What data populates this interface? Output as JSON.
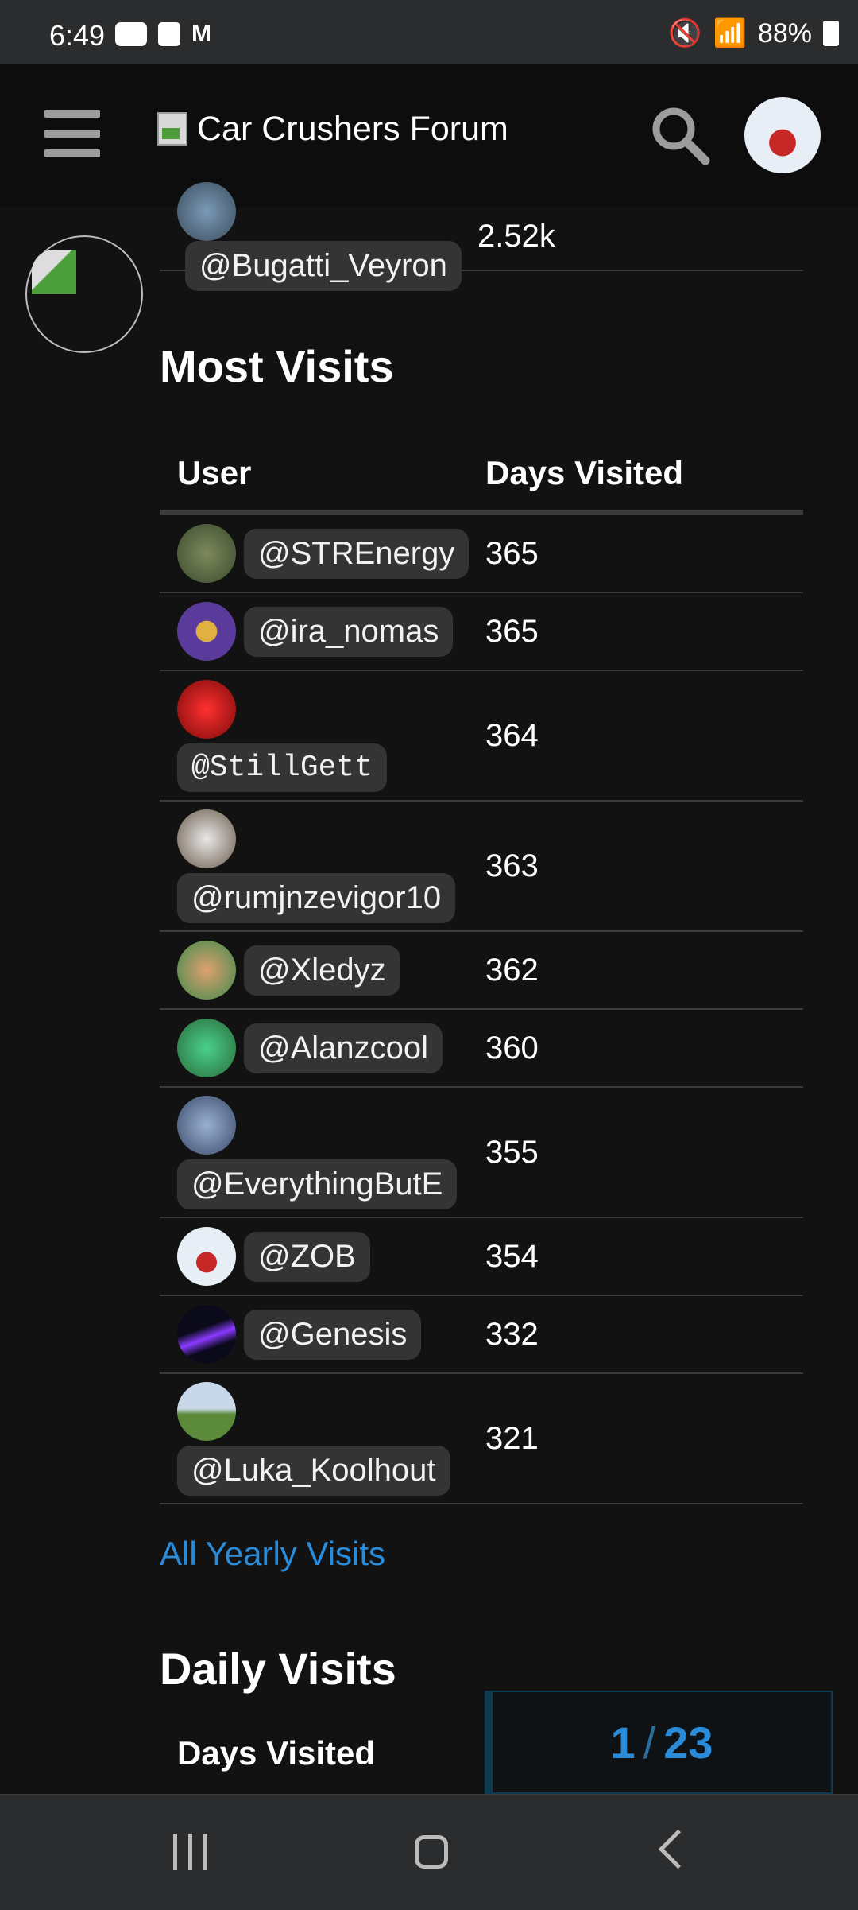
{
  "status_bar": {
    "time": "6:49",
    "battery": "88%"
  },
  "header": {
    "site_title": "Car Crushers Forum"
  },
  "top_row": {
    "username": "@Bugatti_Veyron",
    "value": "2.52k"
  },
  "most_visits": {
    "title": "Most Visits",
    "col_user": "User",
    "col_days": "Days Visited",
    "rows": [
      {
        "username": "@STREnergy",
        "days": "365"
      },
      {
        "username": "@ira_nomas",
        "days": "365"
      },
      {
        "username": "@StillGett",
        "days": "364"
      },
      {
        "username": "@rumjnzevigor10",
        "days": "363"
      },
      {
        "username": "@Xledyz",
        "days": "362"
      },
      {
        "username": "@Alanzcool",
        "days": "360"
      },
      {
        "username": "@EverythingButE",
        "days": "355"
      },
      {
        "username": "@ZOB",
        "days": "354"
      },
      {
        "username": "@Genesis",
        "days": "332"
      },
      {
        "username": "@Luka_Koolhout",
        "days": "321"
      }
    ],
    "link": "All Yearly Visits"
  },
  "daily_visits": {
    "title": "Daily Visits",
    "col_days": "Days Visited"
  },
  "pager": {
    "current": "1",
    "separator": "/",
    "total": "23"
  }
}
